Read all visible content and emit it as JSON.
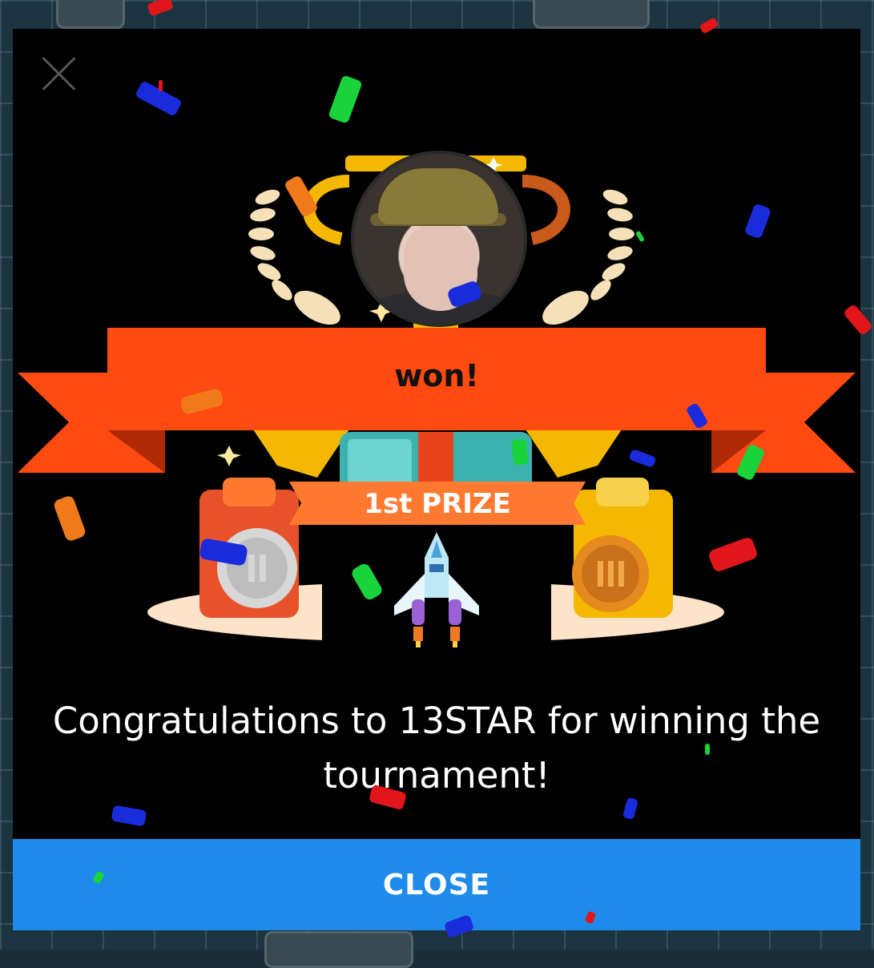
{
  "colors": {
    "banner": "#ff4a12",
    "close_button": "#1e8bea",
    "prize_ribbon": "#ff7a30",
    "trophy_gold": "#f5b800"
  },
  "modal": {
    "close_icon": "close-icon",
    "banner_text": "won!",
    "prize_label": "1st PRIZE",
    "message": "Congratulations to 13STAR for winning the tournament!",
    "close_label": "CLOSE"
  }
}
